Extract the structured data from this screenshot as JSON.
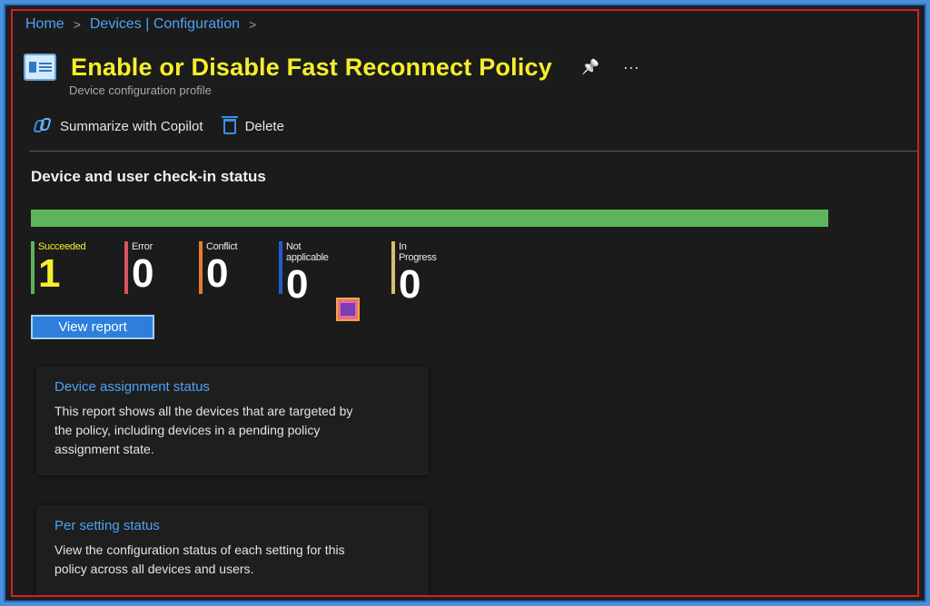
{
  "breadcrumb": {
    "items": [
      "Home",
      "Devices | Configuration"
    ],
    "separator": ">"
  },
  "header": {
    "title": "Enable or Disable Fast Reconnect Policy",
    "subtitle": "Device configuration profile",
    "pin_glyph": "📌",
    "more_glyph": "···",
    "title_color": "#f5ef2a"
  },
  "toolbar": {
    "copilot_label": "Summarize with Copilot",
    "delete_label": "Delete"
  },
  "checkin": {
    "section_title": "Device and user check-in status",
    "progress_fraction": 1.0,
    "progress_color": "#5cb55c",
    "statuses": [
      {
        "label": "Succeeded",
        "value": "1",
        "color": "#5cb55c"
      },
      {
        "label": "Error",
        "value": "0",
        "color": "#d9535f"
      },
      {
        "label": "Conflict",
        "value": "0",
        "color": "#e87c2e"
      },
      {
        "label": "Not applicable",
        "value": "0",
        "color": "#1e5fcf"
      },
      {
        "label": "In Progress",
        "value": "0",
        "color": "#d6c06a"
      }
    ],
    "view_report_label": "View report"
  },
  "cards": [
    {
      "title": "Device assignment status",
      "description": "This report shows all the devices that are targeted by the policy, including devices in a pending policy assignment state."
    },
    {
      "title": "Per setting status",
      "description": "View the configuration status of each setting for this policy across all devices and users."
    }
  ]
}
